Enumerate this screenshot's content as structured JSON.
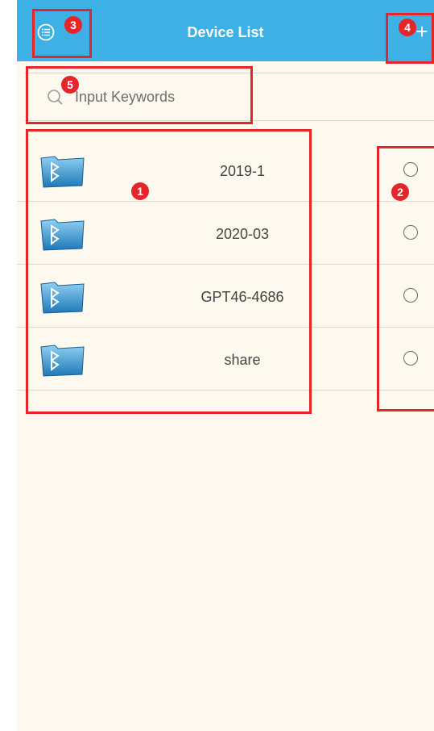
{
  "header": {
    "title": "Device List",
    "menu_icon": "list-menu-icon",
    "add_label": "+"
  },
  "search": {
    "placeholder": "Input Keywords",
    "icon": "search-icon"
  },
  "devices": [
    {
      "name": "2019-1",
      "icon": "bluetooth-folder-icon",
      "selected": false
    },
    {
      "name": "2020-03",
      "icon": "bluetooth-folder-icon",
      "selected": false
    },
    {
      "name": "GPT46-4686",
      "icon": "bluetooth-folder-icon",
      "selected": false
    },
    {
      "name": "share",
      "icon": "bluetooth-folder-icon",
      "selected": false
    }
  ],
  "annotations": {
    "labels": [
      "1",
      "2",
      "3",
      "4",
      "5"
    ],
    "color": "#e8242b"
  },
  "colors": {
    "header": "#3db0e5",
    "background": "#fdf9ef"
  }
}
